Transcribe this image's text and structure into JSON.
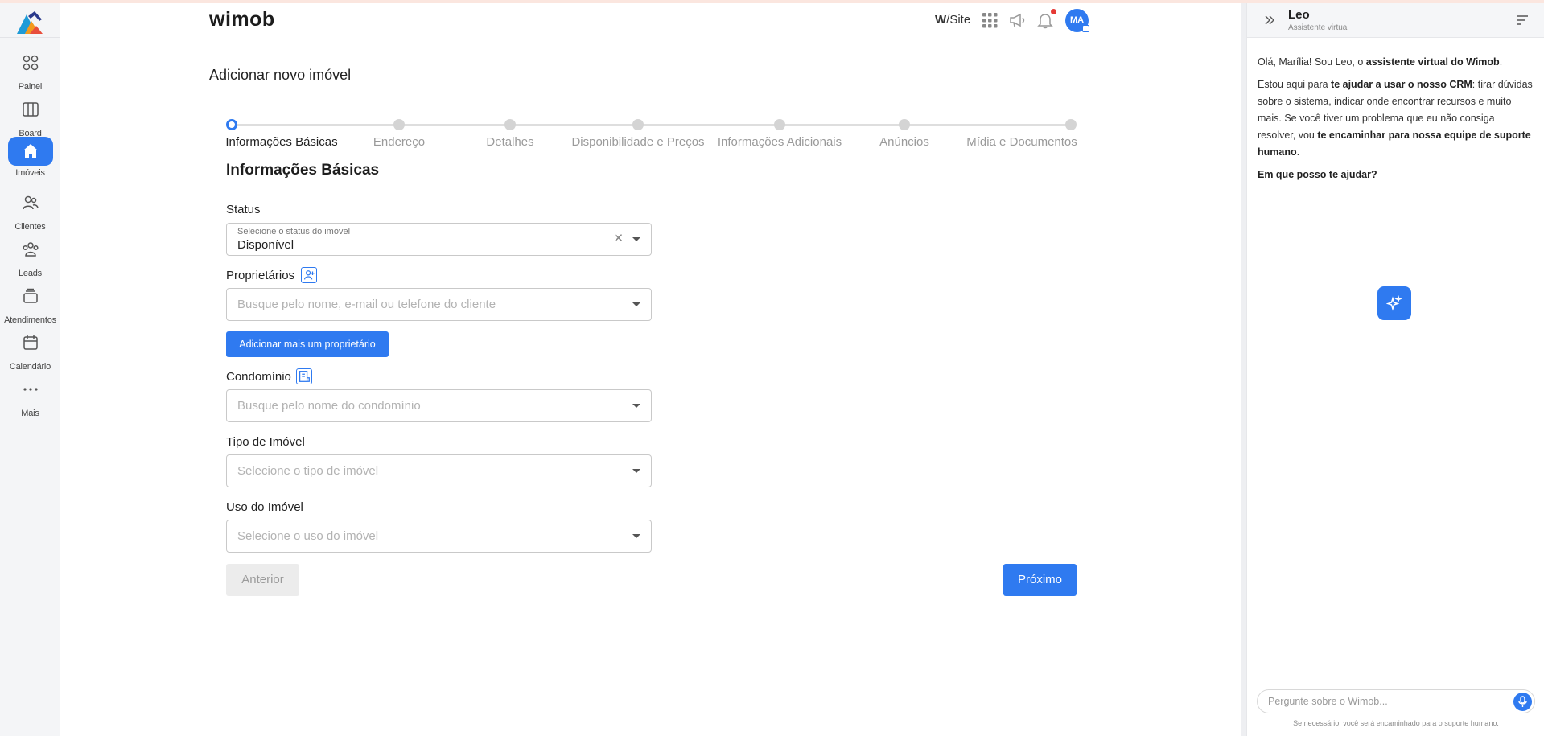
{
  "app": {
    "brand": "wimob"
  },
  "sidebar": {
    "items": [
      {
        "label": "Painel",
        "icon": "dashboard-icon"
      },
      {
        "label": "Board",
        "icon": "board-icon"
      },
      {
        "label": "Imóveis",
        "icon": "home-icon",
        "active": true
      },
      {
        "label": "Clientes",
        "icon": "clients-icon"
      },
      {
        "label": "Leads",
        "icon": "leads-icon"
      },
      {
        "label": "Atendimentos",
        "icon": "inbox-icon"
      },
      {
        "label": "Calendário",
        "icon": "calendar-icon"
      },
      {
        "label": "Mais",
        "icon": "more-icon"
      }
    ]
  },
  "header": {
    "wsite_w": "W",
    "wsite_rest": "/Site",
    "avatar_initials": "MA",
    "accent": "#2f7af0",
    "notification_color": "#e53935"
  },
  "page": {
    "title": "Adicionar novo imóvel"
  },
  "stepper": {
    "steps": [
      "Informações Básicas",
      "Endereço",
      "Detalhes",
      "Disponibilidade e Preços",
      "Informações Adicionais",
      "Anúncios",
      "Mídia e Documentos"
    ],
    "current": 0
  },
  "form": {
    "section_title": "Informações Básicas",
    "status": {
      "label": "Status",
      "hint": "Selecione o status do imóvel",
      "value": "Disponível"
    },
    "owners": {
      "label": "Proprietários",
      "placeholder": "Busque pelo nome, e-mail ou telefone do cliente",
      "add_button": "Adicionar mais um proprietário"
    },
    "condo": {
      "label": "Condomínio",
      "placeholder": "Busque pelo nome do condomínio"
    },
    "type": {
      "label": "Tipo de Imóvel",
      "placeholder": "Selecione o tipo de imóvel"
    },
    "usage": {
      "label": "Uso do Imóvel",
      "placeholder": "Selecione o uso do imóvel"
    },
    "prev_button": "Anterior",
    "next_button": "Próximo"
  },
  "assistant": {
    "name": "Leo",
    "subtitle": "Assistente virtual",
    "msg1_a": "Olá, Marília! Sou Leo, o ",
    "msg1_b": "assistente virtual do Wimob",
    "msg1_c": ".",
    "msg2_a": "Estou aqui para ",
    "msg2_b": "te ajudar a usar o nosso CRM",
    "msg2_c": ": tirar dúvidas sobre o sistema, indicar onde encontrar recursos e muito mais. Se você tiver um problema que eu não consiga resolver, vou ",
    "msg2_d": "te encaminhar para nossa equipe de suporte humano",
    "msg2_e": ".",
    "msg3": "Em que posso te ajudar?",
    "input_placeholder": "Pergunte sobre o Wimob...",
    "footer": "Se necessário, você será encaminhado para o suporte humano."
  }
}
